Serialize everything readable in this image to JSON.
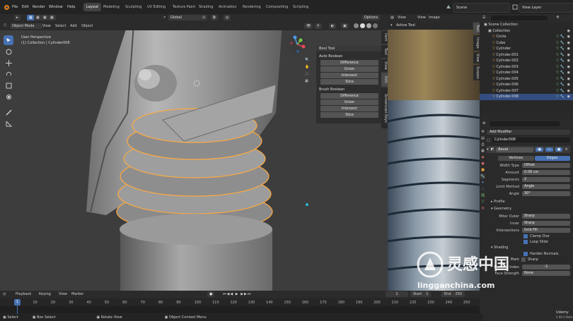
{
  "menu": {
    "items": [
      "File",
      "Edit",
      "Render",
      "Window",
      "Help"
    ]
  },
  "workspaces": {
    "tabs": [
      "Layout",
      "Modeling",
      "Sculpting",
      "UV Editing",
      "Texture Paint",
      "Shading",
      "Animation",
      "Rendering",
      "Compositing",
      "Scripting"
    ],
    "active": "Layout"
  },
  "scene": {
    "name": "Scene",
    "view_layer": "View Layer"
  },
  "viewport_header": {
    "mode": "Object Mode",
    "menus": [
      "View",
      "Select",
      "Add",
      "Object"
    ],
    "transform": "Global",
    "options": "Options"
  },
  "viewport": {
    "view_name": "User Perspective",
    "collection_label": "(1) Collection | Cylinder008"
  },
  "bool_panel": {
    "title": "Bool Tool",
    "auto_label": "Auto Boolean",
    "auto_buttons": [
      "Difference",
      "Union",
      "Intersect",
      "Slice"
    ],
    "brush_label": "Brush Boolean",
    "brush_buttons": [
      "Difference",
      "Union",
      "Intersect",
      "Slice"
    ],
    "side_tabs": [
      "Item",
      "Tool",
      "View",
      "Edit",
      "Screencast Keys"
    ]
  },
  "image_editor": {
    "menus": [
      "View",
      "View",
      "Image"
    ],
    "active_tool": "Active Tool",
    "side_tabs": [
      "Tool",
      "Image",
      "View",
      "Scopes"
    ]
  },
  "outliner": {
    "title": "Scene Collection",
    "collection": "Collection",
    "objects": [
      "Circle",
      "Cube",
      "Cylinder",
      "Cylinder.001",
      "Cylinder.002",
      "Cylinder.003",
      "Cylinder.004",
      "Cylinder.005",
      "Cylinder.006",
      "Cylinder.007",
      "Cylinder.008"
    ],
    "selected": "Cylinder.008"
  },
  "properties": {
    "add_modifier": "Add Modifier",
    "object_name": "Cylinder008",
    "modifier_name": "Bevel",
    "tabs": [
      "Vertices",
      "Edges"
    ],
    "active_tab": "Edges",
    "fields": [
      {
        "label": "Width Type",
        "value": "Offset"
      },
      {
        "label": "Amount",
        "value": "0.08 cm"
      },
      {
        "label": "Segments",
        "value": "2"
      },
      {
        "label": "Limit Method",
        "value": "Angle"
      },
      {
        "label": "Angle",
        "value": "30°"
      }
    ],
    "sections": [
      "Profile",
      "Geometry"
    ],
    "geometry_fields": [
      {
        "label": "Miter Outer",
        "value": "Sharp"
      },
      {
        "label": "Inner",
        "value": "Sharp"
      },
      {
        "label": "Intersections",
        "value": "Grid Fill"
      }
    ],
    "clamp_overlap": "Clamp Ove",
    "loop_slide": "Loop Slide",
    "shading": "Shading",
    "harden_normals": "Harden Normals",
    "mark": "Mark",
    "seam": "Sharp",
    "material_index_label": "Material Index",
    "material_index_value": "-1",
    "face_strength_label": "Face Strength",
    "face_strength_value": "None"
  },
  "timeline": {
    "menus": [
      "Playback",
      "Keying",
      "View",
      "Marker"
    ],
    "current_frame": "1",
    "start_label": "Start",
    "start_value": "1",
    "end_label": "End",
    "end_value": "250",
    "ticks": [
      "0",
      "10",
      "20",
      "30",
      "40",
      "50",
      "60",
      "70",
      "80",
      "90",
      "100",
      "110",
      "120",
      "130",
      "140",
      "150",
      "160",
      "170",
      "180",
      "190",
      "200",
      "210",
      "220",
      "230",
      "240",
      "250"
    ],
    "playhead": "1"
  },
  "statusbar": {
    "items": [
      "Select",
      "Box Select",
      "Rotate View",
      "Object Context Menu"
    ],
    "version": "2.90.0 Beta"
  },
  "watermark": {
    "brand": "灵感中国",
    "url": "lingganchina.com",
    "udemy": "Udemy"
  },
  "colors": {
    "accent": "#4772b3",
    "selection_orange": "#f19a3a",
    "panel": "#2a2a2a",
    "viewport_bg": "#3d3d3d"
  }
}
